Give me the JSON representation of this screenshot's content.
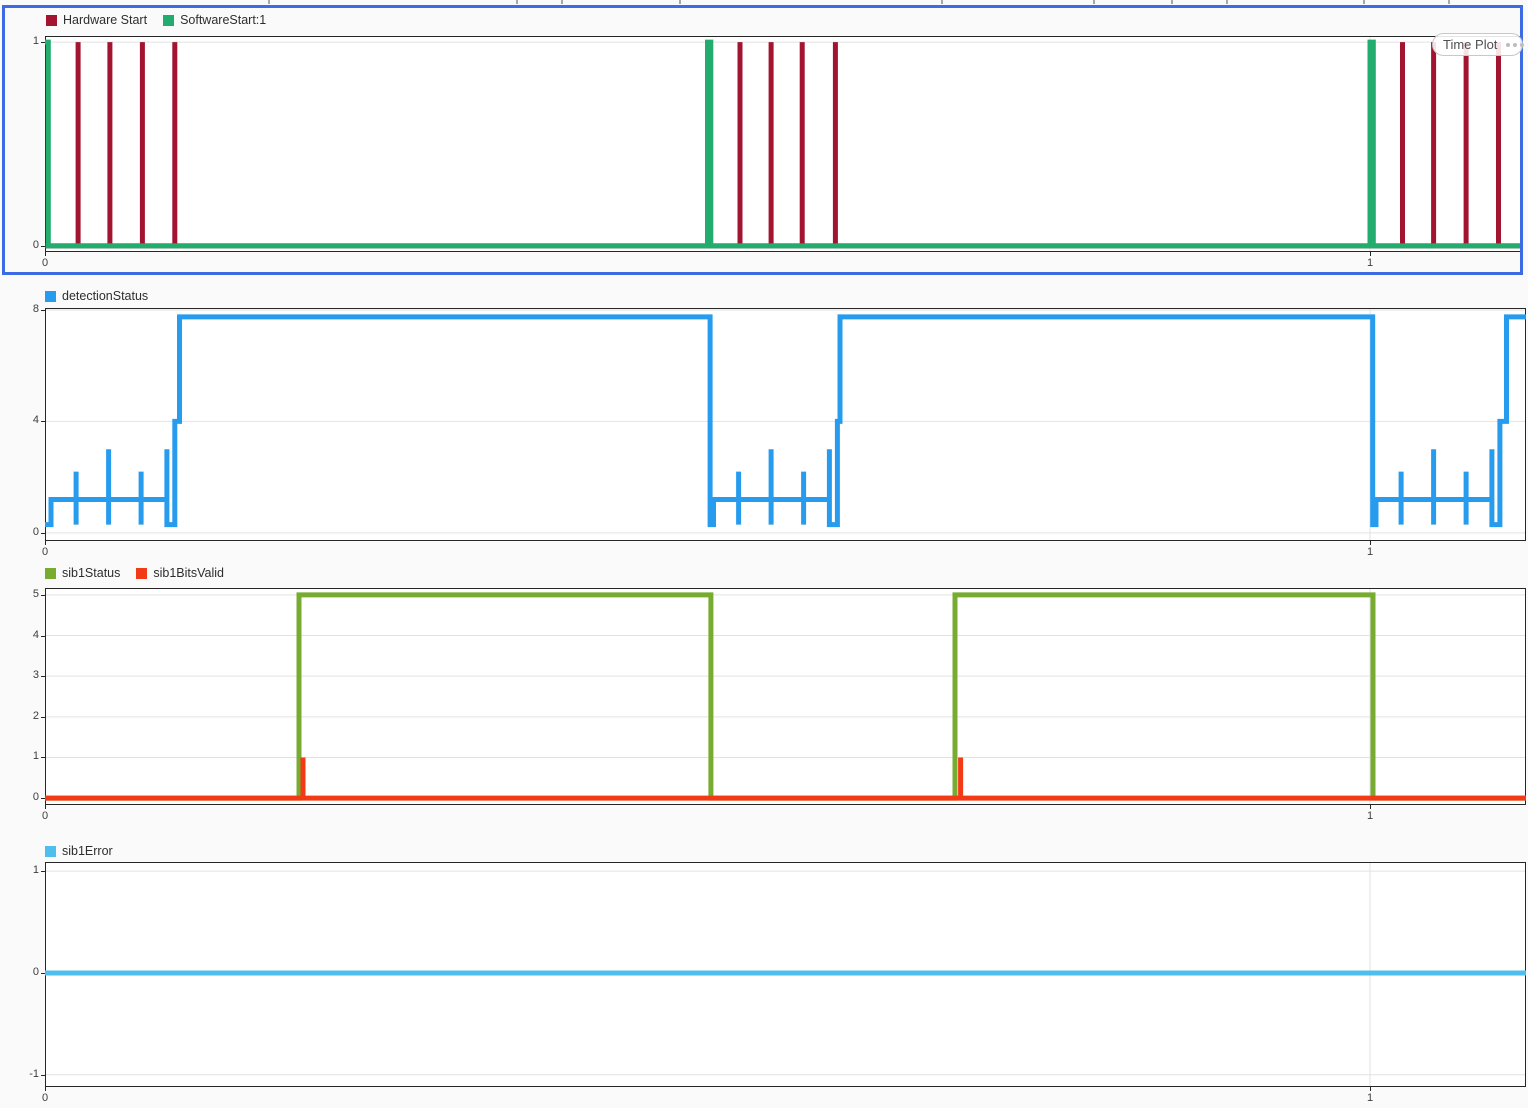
{
  "ui": {
    "time_plot_badge": {
      "label": "Time Plot",
      "dots": 3
    },
    "selection_border_color": "#3D6BE4",
    "top_ruler_ticks_x": [
      268,
      516,
      561,
      679,
      941,
      1093,
      1171,
      1226,
      1363,
      1448
    ]
  },
  "chart_data": [
    {
      "type": "line",
      "step": true,
      "panel": "hardware-software-start",
      "selected": true,
      "title": "",
      "xlabel": "",
      "ylabel": "",
      "xlim": [
        0,
        1.1147
      ],
      "ylim": [
        -0.03,
        1.03
      ],
      "xticks": [
        0,
        1
      ],
      "yticks": [
        1,
        0
      ],
      "grid": {
        "horizontal": [
          0,
          1
        ],
        "vertical": [
          1
        ]
      },
      "legend_position": "top-left",
      "series": [
        {
          "name": "Hardware Start",
          "color": "#A2142F",
          "steps": [
            [
              0,
              0
            ],
            [
              0.025,
              1
            ],
            [
              0.025,
              0
            ],
            [
              0.049,
              1
            ],
            [
              0.049,
              0
            ],
            [
              0.0735,
              1
            ],
            [
              0.0735,
              0
            ],
            [
              0.098,
              1
            ],
            [
              0.098,
              0
            ],
            [
              0.5245,
              1
            ],
            [
              0.5245,
              0
            ],
            [
              0.548,
              1
            ],
            [
              0.548,
              0
            ],
            [
              0.5715,
              1
            ],
            [
              0.5715,
              0
            ],
            [
              0.5965,
              1
            ],
            [
              0.5965,
              0
            ],
            [
              1.0245,
              1
            ],
            [
              1.0245,
              0
            ],
            [
              1.048,
              1
            ],
            [
              1.048,
              0
            ],
            [
              1.0725,
              1
            ],
            [
              1.0725,
              0
            ],
            [
              1.097,
              1
            ],
            [
              1.097,
              0
            ],
            [
              1.1147,
              0
            ]
          ]
        },
        {
          "name": "SoftwareStart:1",
          "color": "#22AC6E",
          "steps": [
            [
              0,
              1
            ],
            [
              0.0025,
              0
            ],
            [
              0.5,
              1
            ],
            [
              0.5025,
              0
            ],
            [
              1.0,
              1
            ],
            [
              1.0025,
              0
            ],
            [
              1.1147,
              0
            ]
          ]
        }
      ]
    },
    {
      "type": "line",
      "step": true,
      "panel": "detection-status",
      "selected": false,
      "title": "",
      "xlabel": "",
      "ylabel": "",
      "xlim": [
        0,
        1.1177
      ],
      "ylim": [
        -0.29,
        8.07
      ],
      "xticks": [
        0,
        1
      ],
      "yticks": [
        8,
        4,
        0
      ],
      "grid": {
        "horizontal": [
          0,
          4,
          8
        ],
        "vertical": [
          1
        ]
      },
      "legend_position": "top-left",
      "series": [
        {
          "name": "detectionStatus",
          "color": "#279CEF",
          "steps": [
            [
              0,
              0.3
            ],
            [
              0.0045,
              1.2
            ],
            [
              0.0235,
              2.2
            ],
            [
              0.0235,
              0.3
            ],
            [
              0.0235,
              1.2
            ],
            [
              0.048,
              3
            ],
            [
              0.048,
              0.3
            ],
            [
              0.048,
              1.2
            ],
            [
              0.0725,
              2.2
            ],
            [
              0.0725,
              0.3
            ],
            [
              0.0725,
              1.2
            ],
            [
              0.092,
              3
            ],
            [
              0.092,
              0.3
            ],
            [
              0.098,
              4
            ],
            [
              0.1015,
              7.75
            ],
            [
              0.502,
              0.3
            ],
            [
              0.5045,
              1.2
            ],
            [
              0.5235,
              2.2
            ],
            [
              0.5235,
              0.3
            ],
            [
              0.5235,
              1.2
            ],
            [
              0.548,
              3
            ],
            [
              0.548,
              0.3
            ],
            [
              0.548,
              1.2
            ],
            [
              0.5725,
              2.2
            ],
            [
              0.5725,
              0.3
            ],
            [
              0.5725,
              1.2
            ],
            [
              0.592,
              3
            ],
            [
              0.592,
              0.3
            ],
            [
              0.598,
              4
            ],
            [
              0.6,
              7.75
            ],
            [
              1.002,
              0.3
            ],
            [
              1.0045,
              1.2
            ],
            [
              1.0235,
              2.2
            ],
            [
              1.0235,
              0.3
            ],
            [
              1.0235,
              1.2
            ],
            [
              1.048,
              3
            ],
            [
              1.048,
              0.3
            ],
            [
              1.048,
              1.2
            ],
            [
              1.0725,
              2.2
            ],
            [
              1.0725,
              0.3
            ],
            [
              1.0725,
              1.2
            ],
            [
              1.092,
              3
            ],
            [
              1.092,
              0.3
            ],
            [
              1.098,
              4
            ],
            [
              1.103,
              7.75
            ],
            [
              1.1177,
              7.75
            ]
          ]
        }
      ]
    },
    {
      "type": "line",
      "step": true,
      "panel": "sib1-status-bitsvalid",
      "selected": false,
      "title": "",
      "xlabel": "",
      "ylabel": "",
      "xlim": [
        0,
        1.1177
      ],
      "ylim": [
        -0.17,
        5.17
      ],
      "xticks": [
        0,
        1
      ],
      "yticks": [
        5,
        4,
        3,
        2,
        1,
        0
      ],
      "grid": {
        "horizontal": [
          0,
          1,
          2,
          3,
          4,
          5
        ],
        "vertical": [
          1
        ]
      },
      "legend_position": "top-left",
      "series": [
        {
          "name": "sib1Status",
          "color": "#77AC30",
          "steps": [
            [
              0,
              0
            ],
            [
              0.1917,
              5
            ],
            [
              0.5026,
              0
            ],
            [
              0.6868,
              5
            ],
            [
              1.0023,
              0
            ],
            [
              1.1177,
              0
            ]
          ]
        },
        {
          "name": "sib1BitsValid",
          "color": "#F23A16",
          "steps": [
            [
              0,
              0
            ],
            [
              0.1947,
              1
            ],
            [
              0.1947,
              0
            ],
            [
              0.691,
              1
            ],
            [
              0.691,
              0
            ],
            [
              1.1177,
              0
            ]
          ]
        }
      ]
    },
    {
      "type": "line",
      "step": true,
      "panel": "sib1-error",
      "selected": false,
      "title": "",
      "xlabel": "",
      "ylabel": "",
      "xlim": [
        0,
        1.1177
      ],
      "ylim": [
        -1.12,
        1.09
      ],
      "xticks": [
        0,
        1
      ],
      "yticks": [
        1,
        0,
        -1
      ],
      "grid": {
        "horizontal": [
          -1,
          0,
          1
        ],
        "vertical": [
          1
        ]
      },
      "legend_position": "top-left",
      "series": [
        {
          "name": "sib1Error",
          "color": "#4DBEEE",
          "steps": [
            [
              0,
              0
            ],
            [
              1.1177,
              0
            ]
          ]
        }
      ]
    }
  ]
}
